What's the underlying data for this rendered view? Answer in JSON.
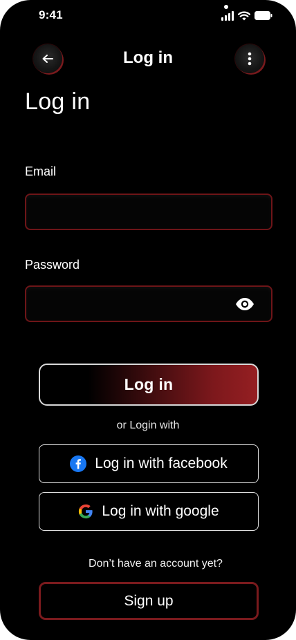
{
  "status_bar": {
    "time": "9:41"
  },
  "header": {
    "title": "Log in"
  },
  "page": {
    "title": "Log in"
  },
  "form": {
    "email_label": "Email",
    "email_value": "",
    "password_label": "Password",
    "password_value": ""
  },
  "actions": {
    "login_label": "Log in",
    "or_text": "or Login with",
    "facebook_label": "Log in with facebook",
    "google_label": "Log in with google",
    "no_account_text": "Don’t have an account yet?",
    "signup_label": "Sign up"
  },
  "colors": {
    "background": "#000000",
    "accent": "#7a1a1d",
    "facebook": "#1877f2"
  },
  "icons": {
    "back": "arrow-left-icon",
    "more": "more-vertical-icon",
    "password_toggle": "eye-icon",
    "facebook": "facebook-icon",
    "google": "google-icon"
  }
}
